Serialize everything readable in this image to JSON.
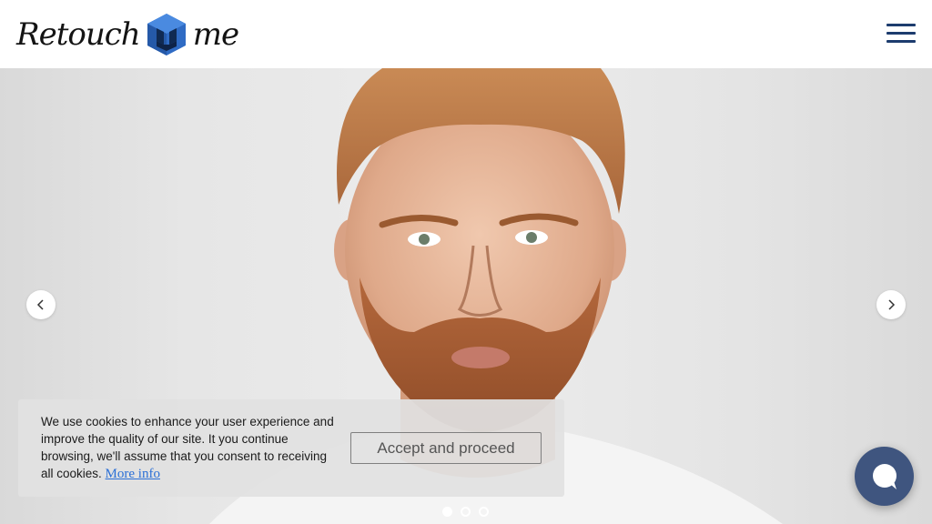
{
  "header": {
    "logo_text_left": "Retouch",
    "logo_text_right": "me",
    "menu_icon": "hamburger-menu-icon"
  },
  "hero": {
    "prev_icon": "chevron-left-icon",
    "next_icon": "chevron-right-icon",
    "slides": 3,
    "active_slide": 1
  },
  "cookie_banner": {
    "message": "We use cookies to enhance your user experience and improve the quality of our site. It you continue browsing, we'll assume that you consent to receiving all cookies. ",
    "link_text": "More info",
    "accept_label": "Accept and proceed"
  },
  "chat": {
    "icon": "chat-bubble-icon"
  },
  "colors": {
    "brand_navy": "#1d3c6e",
    "brand_blue": "#2f6bc4",
    "chat_bg": "#3f557f",
    "link": "#2a6fd6"
  }
}
